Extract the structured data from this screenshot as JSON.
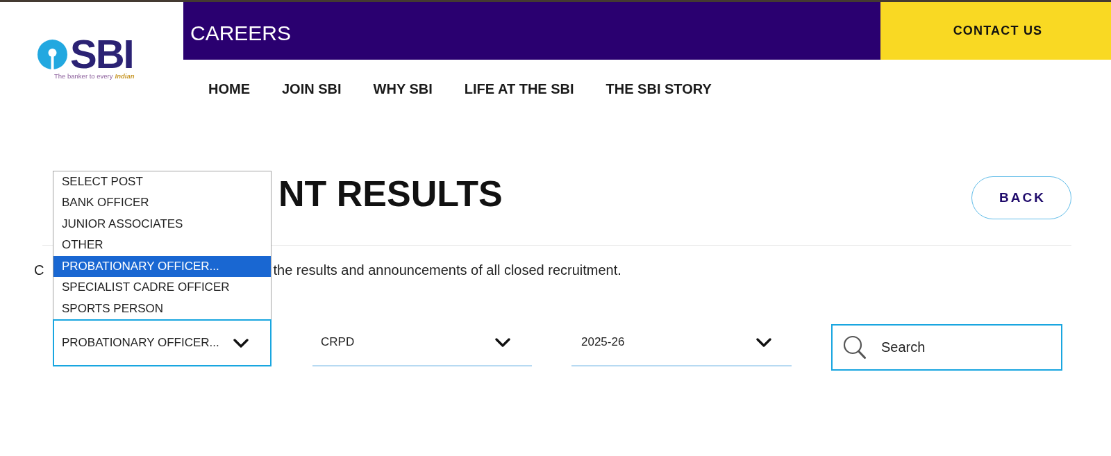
{
  "logo": {
    "wordmark": "SBI",
    "tagline": "The banker to every",
    "tagline_highlight": "Indian"
  },
  "header": {
    "title": "CAREERS",
    "contact_button": "CONTACT US"
  },
  "nav": [
    "HOME",
    "JOIN SBI",
    "WHY SBI",
    "LIFE AT THE SBI",
    "THE SBI STORY"
  ],
  "page": {
    "title": "NT RESULTS",
    "back_button": "BACK",
    "description_start": "C",
    "description": "the results and announcements of all closed recruitment."
  },
  "filters": [
    {
      "value": "PROBATIONARY OFFICER...",
      "open": true,
      "options": [
        {
          "label": "SELECT POST",
          "selected": false
        },
        {
          "label": "BANK OFFICER",
          "selected": false
        },
        {
          "label": "JUNIOR ASSOCIATES",
          "selected": false
        },
        {
          "label": "OTHER",
          "selected": false
        },
        {
          "label": "PROBATIONARY OFFICER...",
          "selected": true
        },
        {
          "label": "SPECIALIST CADRE OFFICER",
          "selected": false
        },
        {
          "label": "SPORTS PERSON",
          "selected": false
        }
      ]
    },
    {
      "value": "CRPD",
      "open": false
    },
    {
      "value": "2025-26",
      "open": false
    }
  ],
  "search": {
    "placeholder": "Search"
  }
}
